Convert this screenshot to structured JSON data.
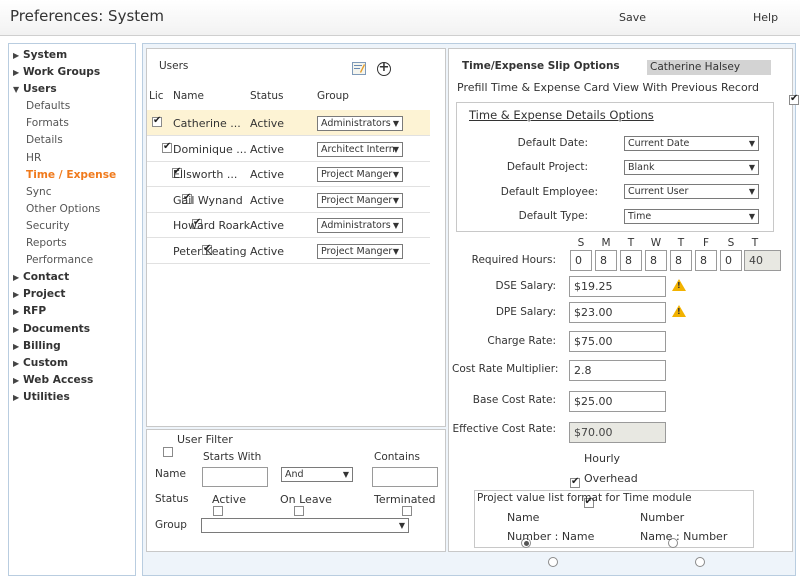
{
  "header": {
    "title": "Preferences: System",
    "save_label": "Save",
    "help_label": "Help"
  },
  "sidebar": {
    "items": [
      {
        "label": "System",
        "level": "top",
        "expanded": false
      },
      {
        "label": "Work Groups",
        "level": "top",
        "expanded": false
      },
      {
        "label": "Users",
        "level": "top",
        "expanded": true
      },
      {
        "label": "Defaults",
        "level": "sub"
      },
      {
        "label": "Formats",
        "level": "sub"
      },
      {
        "label": "Details",
        "level": "sub"
      },
      {
        "label": "HR",
        "level": "sub"
      },
      {
        "label": "Time / Expense",
        "level": "sub",
        "active": true
      },
      {
        "label": "Sync",
        "level": "sub"
      },
      {
        "label": "Other Options",
        "level": "sub"
      },
      {
        "label": "Security",
        "level": "sub"
      },
      {
        "label": "Reports",
        "level": "sub"
      },
      {
        "label": "Performance",
        "level": "sub"
      },
      {
        "label": "Contact",
        "level": "top",
        "expanded": false
      },
      {
        "label": "Project",
        "level": "top",
        "expanded": false
      },
      {
        "label": "RFP",
        "level": "top",
        "expanded": false
      },
      {
        "label": "Documents",
        "level": "top",
        "expanded": false
      },
      {
        "label": "Billing",
        "level": "top",
        "expanded": false
      },
      {
        "label": "Custom",
        "level": "top",
        "expanded": false
      },
      {
        "label": "Web Access",
        "level": "top",
        "expanded": false
      },
      {
        "label": "Utilities",
        "level": "top",
        "expanded": false
      }
    ]
  },
  "users": {
    "title": "Users",
    "columns": {
      "lic": "Lic",
      "name": "Name",
      "status": "Status",
      "group": "Group"
    },
    "rows": [
      {
        "name": "Catherine ...",
        "status": "Active",
        "group": "Administrators",
        "lic": true,
        "selected": true
      },
      {
        "name": "Dominique ...",
        "status": "Active",
        "group": "Architect Intern",
        "lic": true
      },
      {
        "name": "Ellsworth ...",
        "status": "Active",
        "group": "Project Manger",
        "lic": true
      },
      {
        "name": "Gail Wynand",
        "status": "Active",
        "group": "Project Manger",
        "lic": true
      },
      {
        "name": "Howard Roark",
        "status": "Active",
        "group": "Administrators",
        "lic": true
      },
      {
        "name": "Peter Keating",
        "status": "Active",
        "group": "Project Manger",
        "lic": true
      }
    ]
  },
  "filter": {
    "user_filter_label": "User Filter",
    "starts_with_label": "Starts With",
    "contains_label": "Contains",
    "name_label": "Name",
    "and_value": "And",
    "status_label": "Status",
    "active_label": "Active",
    "on_leave_label": "On Leave",
    "terminated_label": "Terminated",
    "group_label": "Group"
  },
  "slip": {
    "title": "Time/Expense Slip Options",
    "user": "Catherine Halsey",
    "prefill_label": "Prefill Time & Expense Card View With Previous Record",
    "details_title": "Time & Expense Details Options",
    "default_date_label": "Default Date:",
    "default_date_value": "Current Date",
    "default_project_label": "Default Project:",
    "default_project_value": "Blank",
    "default_employee_label": "Default Employee:",
    "default_employee_value": "Current User",
    "default_type_label": "Default Type:",
    "default_type_value": "Time",
    "days": [
      "S",
      "M",
      "T",
      "W",
      "T",
      "F",
      "S",
      "T"
    ],
    "required_hours_label": "Required Hours:",
    "hours": [
      "0",
      "8",
      "8",
      "8",
      "8",
      "8",
      "0"
    ],
    "hours_total": "40",
    "dse_salary_label": "DSE Salary:",
    "dse_salary_value": "$19.25",
    "dpe_salary_label": "DPE Salary:",
    "dpe_salary_value": "$23.00",
    "charge_rate_label": "Charge Rate:",
    "charge_rate_value": "$75.00",
    "cost_mult_label": "Cost Rate Multiplier:",
    "cost_mult_value": "2.8",
    "base_cost_label": "Base Cost Rate:",
    "base_cost_value": "$25.00",
    "eff_cost_label": "Effective Cost Rate:",
    "eff_cost_value": "$70.00",
    "hourly_label": "Hourly",
    "overhead_label": "Overhead",
    "format_title": "Project value list format for Time module",
    "fmt_name": "Name",
    "fmt_number": "Number",
    "fmt_number_name": "Number : Name",
    "fmt_name_number": "Name : Number"
  },
  "colors": {
    "accent": "#f07a1c",
    "selected_row": "#fdf3d4",
    "border": "#b9cde0"
  }
}
